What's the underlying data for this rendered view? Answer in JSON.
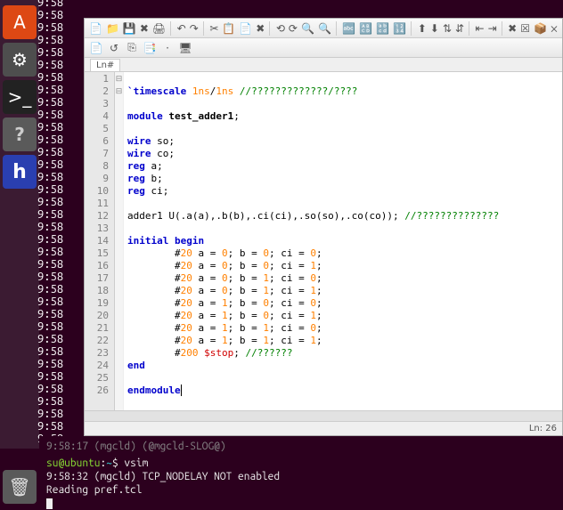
{
  "launcher": {
    "items": [
      {
        "name": "software-center-icon",
        "glyph": "A",
        "class": "li-orange"
      },
      {
        "name": "settings-icon",
        "glyph": "⚙",
        "class": "li-grey"
      },
      {
        "name": "terminal-icon",
        "glyph": ">_",
        "class": "li-dark"
      },
      {
        "name": "help-icon",
        "glyph": "?",
        "class": "li-q"
      },
      {
        "name": "editor-app-icon",
        "glyph": "h",
        "class": "li-blue"
      }
    ],
    "trash": {
      "glyph": "🗑"
    }
  },
  "clock": {
    "time": "9:58",
    "repeat": 36,
    "last": "9:58:17"
  },
  "toolbar": {
    "main": [
      "📄",
      "📁",
      "💾",
      "✖",
      "🖨",
      "|",
      "↶",
      "↷",
      "|",
      "✂",
      "📋",
      "📄",
      "✖",
      "|",
      "⟲",
      "⟳",
      "🔍",
      "🔍",
      "|",
      "🔤",
      "🔠",
      "🔡",
      "🔢",
      "|",
      "⬆",
      "⬇",
      "⇅",
      "⇵",
      "|",
      "⇤",
      "⇥",
      "|",
      "✖",
      "☒",
      "📦",
      "❌"
    ],
    "sub": [
      "📄",
      "↺",
      "⎘",
      "📑",
      "·",
      "🖥"
    ]
  },
  "tab": {
    "label": "Ln#"
  },
  "status": {
    "text": "Ln: 26"
  },
  "code": {
    "lines": [
      {
        "n": 1,
        "html": ""
      },
      {
        "n": 2,
        "html": "<span class='k-red'>`timescale</span> <span class='k-num'>1ns</span>/<span class='k-num'>1ns</span> <span class='k-comment'>//?????????????/????</span>"
      },
      {
        "n": 3,
        "html": ""
      },
      {
        "n": 4,
        "fold": "⊟",
        "html": "<span class='k-bluekw'>module</span> <span class='k-black'>test_adder1</span>;"
      },
      {
        "n": 5,
        "html": ""
      },
      {
        "n": 6,
        "html": "<span class='k-bluekw'>wire</span> so;"
      },
      {
        "n": 7,
        "html": "<span class='k-bluekw'>wire</span> co;"
      },
      {
        "n": 8,
        "html": "<span class='k-bluekw'>reg</span> a;"
      },
      {
        "n": 9,
        "html": "<span class='k-bluekw'>reg</span> b;"
      },
      {
        "n": 10,
        "html": "<span class='k-bluekw'>reg</span> ci;"
      },
      {
        "n": 11,
        "html": ""
      },
      {
        "n": 12,
        "html": "adder1 U(.a(a),.b(b),.ci(ci),.so(so),.co(co)); <span class='k-comment'>//??????????????</span>"
      },
      {
        "n": 13,
        "html": ""
      },
      {
        "n": 14,
        "fold": "⊟",
        "html": "<span class='k-bluekw'>initial</span> <span class='k-bluekw'>begin</span>"
      },
      {
        "n": 15,
        "html": "        #<span class='k-num'>20</span> a = <span class='k-num'>0</span>; b = <span class='k-num'>0</span>; ci = <span class='k-num'>0</span>;"
      },
      {
        "n": 16,
        "html": "        #<span class='k-num'>20</span> a = <span class='k-num'>0</span>; b = <span class='k-num'>0</span>; ci = <span class='k-num'>1</span>;"
      },
      {
        "n": 17,
        "html": "        #<span class='k-num'>20</span> a = <span class='k-num'>0</span>; b = <span class='k-num'>1</span>; ci = <span class='k-num'>0</span>;"
      },
      {
        "n": 18,
        "html": "        #<span class='k-num'>20</span> a = <span class='k-num'>0</span>; b = <span class='k-num'>1</span>; ci = <span class='k-num'>1</span>;"
      },
      {
        "n": 19,
        "html": "        #<span class='k-num'>20</span> a = <span class='k-num'>1</span>; b = <span class='k-num'>0</span>; ci = <span class='k-num'>0</span>;"
      },
      {
        "n": 20,
        "html": "        #<span class='k-num'>20</span> a = <span class='k-num'>1</span>; b = <span class='k-num'>0</span>; ci = <span class='k-num'>1</span>;"
      },
      {
        "n": 21,
        "html": "        #<span class='k-num'>20</span> a = <span class='k-num'>1</span>; b = <span class='k-num'>1</span>; ci = <span class='k-num'>0</span>;"
      },
      {
        "n": 22,
        "html": "        #<span class='k-num'>20</span> a = <span class='k-num'>1</span>; b = <span class='k-num'>1</span>; ci = <span class='k-num'>1</span>;"
      },
      {
        "n": 23,
        "html": "        #<span class='k-num'>200</span> <span class='k-sys'>$stop</span>; <span class='k-comment'>//??????</span>"
      },
      {
        "n": 24,
        "html": "<span class='k-bluekw'>end</span>"
      },
      {
        "n": 25,
        "html": ""
      },
      {
        "n": 26,
        "html": "<span class='k-bluekw'>endmodule</span><span class='cur'></span>"
      }
    ]
  },
  "terminal": {
    "dimline": "9:58:17 (mgcld) (@mgcld-SLOG@)",
    "prompt_user": "su@ubuntu",
    "prompt_sep": ":",
    "prompt_path": "~",
    "prompt_dollar": "$ ",
    "cmd": "vsim",
    "line2": "  9:58:32 (mgcld) TCP_NODELAY NOT enabled",
    "line3": "Reading pref.tcl"
  }
}
